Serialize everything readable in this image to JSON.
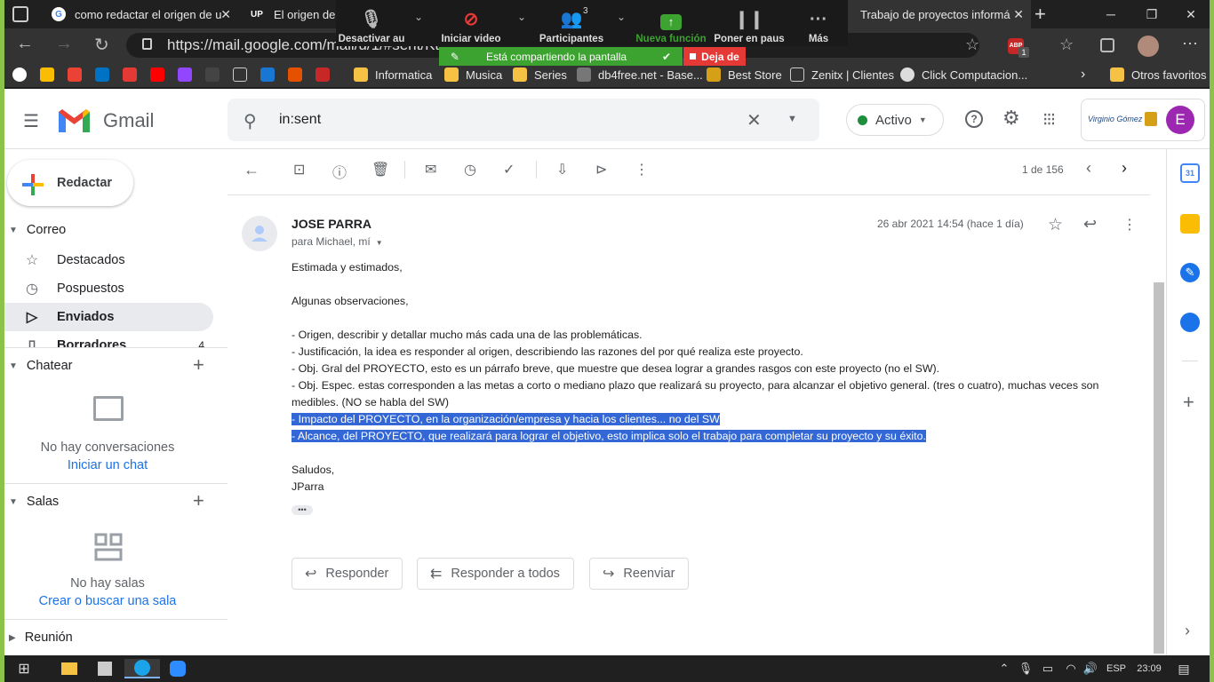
{
  "browser": {
    "tabs": [
      {
        "label": "como redactar el origen de u"
      },
      {
        "label": "El origen de lo"
      },
      {
        "label": "Trabajo de proyectos informá"
      }
    ],
    "tab2_icon_text": "UP",
    "url": "https://mail.google.com/mail/u/1/#sent/Kt",
    "bookmarks": [
      {
        "label": "Informatica"
      },
      {
        "label": "Musica"
      },
      {
        "label": "Series"
      },
      {
        "label": "db4free.net - Base..."
      },
      {
        "label": "Best Store"
      },
      {
        "label": "Zenitx | Clientes"
      },
      {
        "label": "Click Computacion..."
      },
      {
        "label": "Otros favoritos"
      }
    ],
    "abp_badge": "1"
  },
  "zoom": {
    "mute_label": "Desactivar au",
    "video_label": "Iniciar video",
    "participants_label": "Participantes",
    "participants_count": "3",
    "new_feature_label": "Nueva función",
    "pause_label": "Poner en paus",
    "more_label": "Más",
    "sharing_text": "Está compartiendo la pantalla",
    "stop_label": "Deja de"
  },
  "gmail": {
    "app_name": "Gmail",
    "search_value": "in:sent",
    "status_label": "Activo",
    "avatar_letter": "E",
    "logo_text": "Virginio Gómez",
    "compose_label": "Redactar",
    "mail_section": "Correo",
    "nav": [
      {
        "label": "Destacados",
        "icon": "star-icon"
      },
      {
        "label": "Pospuestos",
        "icon": "clock-icon"
      },
      {
        "label": "Enviados",
        "icon": "send-icon"
      },
      {
        "label": "Borradores",
        "icon": "draft-icon",
        "count": "4"
      }
    ],
    "chat_section": "Chatear",
    "chat_empty": "No hay conversaciones",
    "chat_link": "Iniciar un chat",
    "rooms_section": "Salas",
    "rooms_empty": "No hay salas",
    "rooms_link": "Crear o buscar una sala",
    "meet_section": "Reunión",
    "pager": "1 de 156",
    "message": {
      "sender": "JOSE PARRA",
      "to": "para Michael, mí",
      "date": "26 abr 2021 14:54 (hace 1 día)",
      "body": {
        "greeting": "Estimada y estimados,",
        "intro": "Algunas observaciones,",
        "line1": "- Origen, describir y detallar mucho más cada una de las problemáticas.",
        "line2": "- Justificación, la idea es responder al origen, describiendo las razones del por qué realiza este proyecto.",
        "line3": "- Obj. Gral del PROYECTO, esto es un párrafo breve, que muestre que desea lograr a grandes rasgos con este proyecto (no el SW).",
        "line4": "- Obj. Espec. estas corresponden a las metas a corto o mediano plazo que realizará su proyecto, para alcanzar el objetivo general. (tres o cuatro), muchas veces son medibles. (NO se habla del SW)",
        "line5": "- Impacto del PROYECTO, en la organización/empresa y hacia los clientes... no del SW",
        "line6": "- Alcance, del PROYECTO, que realizará para lograr el objetivo, esto implica solo el trabajo para completar su proyecto y su éxito.",
        "closing": "Saludos,",
        "signature": "JParra"
      }
    },
    "reply_label": "Responder",
    "reply_all_label": "Responder a todos",
    "forward_label": "Reenviar",
    "calendar_day": "31"
  },
  "taskbar": {
    "language": "ESP",
    "time": "23:09"
  },
  "colors": {
    "highlight": "#3367d6",
    "gmail_red": "#ea4335",
    "zoom_green": "#3ca230",
    "stop_red": "#e53935",
    "desktop_green": "#8bc34a"
  }
}
